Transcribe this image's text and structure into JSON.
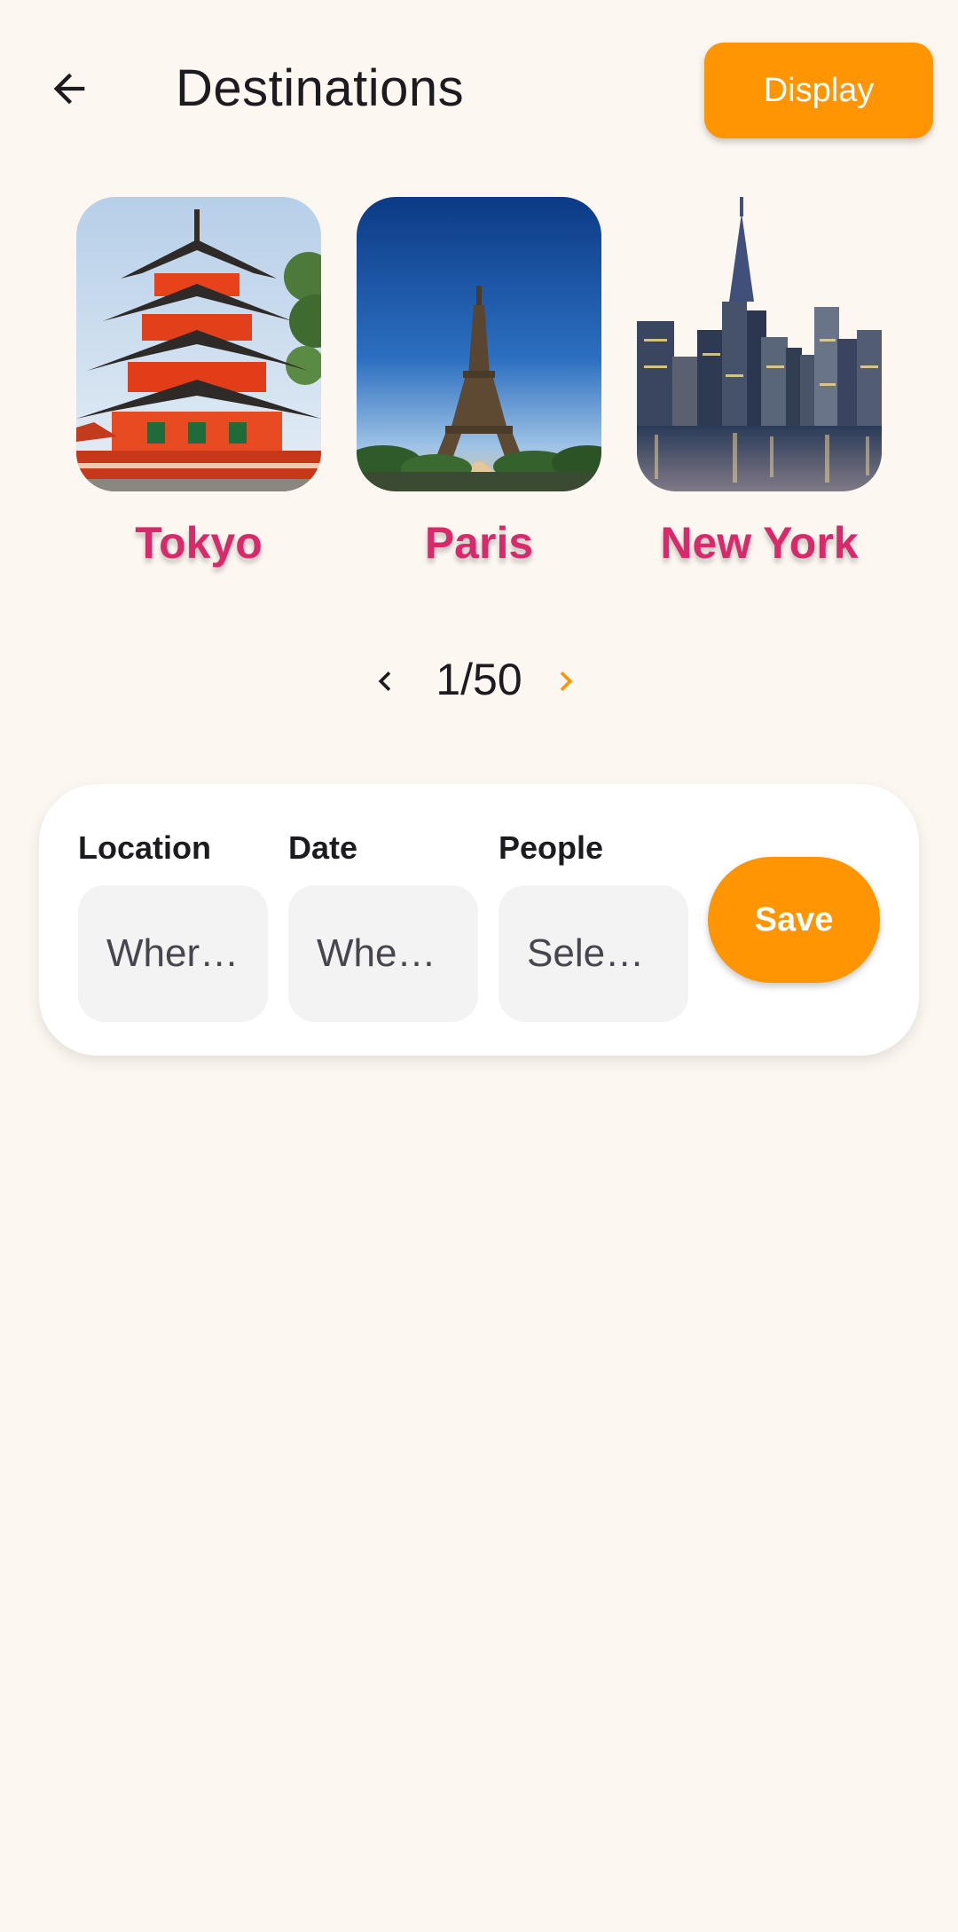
{
  "app_bar": {
    "back_icon": "arrow-left-icon",
    "title": "Destinations",
    "display_label": "Display"
  },
  "destinations": [
    {
      "name": "Tokyo",
      "image": "pagoda-photo"
    },
    {
      "name": "Paris",
      "image": "eiffel-tower-photo"
    },
    {
      "name": "New York",
      "image": "manhattan-skyline-photo"
    }
  ],
  "pager": {
    "prev_icon": "chevron-left-icon",
    "count": "1/50",
    "next_icon": "chevron-right-icon"
  },
  "booking": {
    "location": {
      "label": "Location",
      "placeholder": "Where…"
    },
    "date": {
      "label": "Date",
      "placeholder": "When…"
    },
    "people": {
      "label": "People",
      "placeholder": "Select…"
    },
    "save_label": "Save"
  },
  "colors": {
    "background": "#fdf7f1",
    "accent": "#ff9502",
    "destination_name": "#d82a6a",
    "input_background": "#f3f3f3"
  }
}
